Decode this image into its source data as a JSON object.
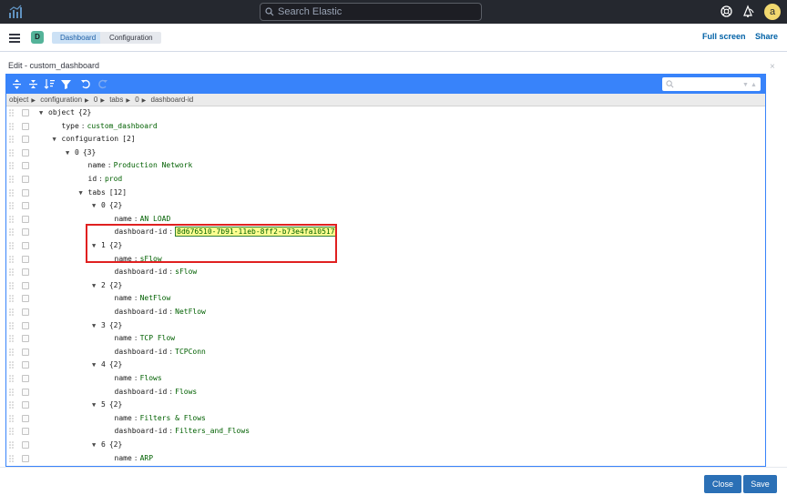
{
  "header": {
    "search_placeholder": "Search Elastic",
    "avatar_initial": "a"
  },
  "subbar": {
    "space_badge": "D",
    "breadcrumbs": [
      "Dashboard",
      "Configuration"
    ],
    "full_screen": "Full screen",
    "share": "Share"
  },
  "modal": {
    "title": "Edit - custom_dashboard",
    "close_glyph": "×",
    "close_label": "Close",
    "save_label": "Save"
  },
  "editor": {
    "path": [
      "object",
      "configuration",
      "0",
      "tabs",
      "0",
      "dashboard-id"
    ],
    "rows": [
      {
        "indent": 0,
        "expand": true,
        "key": "object",
        "count": "{2}"
      },
      {
        "indent": 1,
        "key": "type",
        "value": "custom_dashboard"
      },
      {
        "indent": 1,
        "expand": true,
        "key": "configuration",
        "count": "[2]"
      },
      {
        "indent": 2,
        "expand": true,
        "key": "0",
        "count": "{3}"
      },
      {
        "indent": 3,
        "key": "name",
        "value": "Production Network"
      },
      {
        "indent": 3,
        "key": "id",
        "value": "prod"
      },
      {
        "indent": 3,
        "expand": true,
        "key": "tabs",
        "count": "[12]"
      },
      {
        "indent": 4,
        "expand": true,
        "key": "0",
        "count": "{2}"
      },
      {
        "indent": 5,
        "key": "name",
        "value": "AN LOAD"
      },
      {
        "indent": 5,
        "key": "dashboard-id",
        "value": "8d676510-7b91-11eb-8ff2-b73e4fa10517",
        "highlight": true
      },
      {
        "indent": 4,
        "expand": true,
        "key": "1",
        "count": "{2}"
      },
      {
        "indent": 5,
        "key": "name",
        "value": "sFlow"
      },
      {
        "indent": 5,
        "key": "dashboard-id",
        "value": "sFlow"
      },
      {
        "indent": 4,
        "expand": true,
        "key": "2",
        "count": "{2}"
      },
      {
        "indent": 5,
        "key": "name",
        "value": "NetFlow"
      },
      {
        "indent": 5,
        "key": "dashboard-id",
        "value": "NetFlow"
      },
      {
        "indent": 4,
        "expand": true,
        "key": "3",
        "count": "{2}"
      },
      {
        "indent": 5,
        "key": "name",
        "value": "TCP Flow"
      },
      {
        "indent": 5,
        "key": "dashboard-id",
        "value": "TCPConn"
      },
      {
        "indent": 4,
        "expand": true,
        "key": "4",
        "count": "{2}"
      },
      {
        "indent": 5,
        "key": "name",
        "value": "Flows"
      },
      {
        "indent": 5,
        "key": "dashboard-id",
        "value": "Flows"
      },
      {
        "indent": 4,
        "expand": true,
        "key": "5",
        "count": "{2}"
      },
      {
        "indent": 5,
        "key": "name",
        "value": "Filters & Flows"
      },
      {
        "indent": 5,
        "key": "dashboard-id",
        "value": "Filters_and_Flows"
      },
      {
        "indent": 4,
        "expand": true,
        "key": "6",
        "count": "{2}"
      },
      {
        "indent": 5,
        "key": "name",
        "value": "ARP"
      }
    ]
  },
  "colors": {
    "header_bg": "#25282f",
    "toolbar_blue": "#3883fa",
    "button_blue": "#2b70b6",
    "highlight_box": "#e02020",
    "value_green": "#006000"
  },
  "icons": [
    "elastic-logo-icon",
    "search-icon",
    "help-icon",
    "newsfeed-icon",
    "expand-all-icon",
    "collapse-all-icon",
    "sort-icon",
    "filter-icon",
    "undo-icon",
    "redo-icon"
  ]
}
